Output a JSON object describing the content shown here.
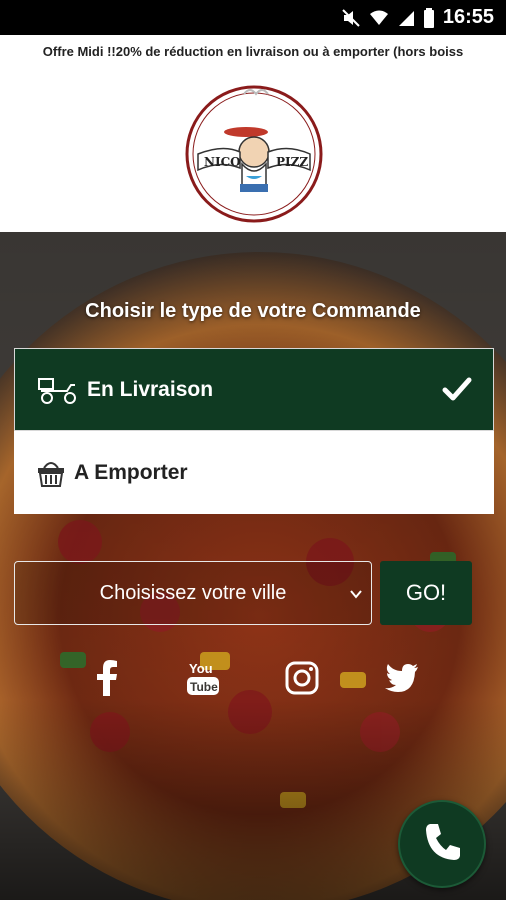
{
  "status_bar": {
    "time": "16:55"
  },
  "marquee": {
    "text": "Offre Midi !!20% de réduction en livraison ou à emporter (hors boiss"
  },
  "logo": {
    "alt": "NICO PIZZ'"
  },
  "order": {
    "heading": "Choisir le type de votre Commande",
    "delivery_label": "En Livraison",
    "takeaway_label": "A Emporter",
    "selected": "delivery"
  },
  "city": {
    "placeholder": "Choisissez votre ville"
  },
  "go_label": "GO!",
  "social": {
    "youtube_text": "You Tube"
  },
  "colors": {
    "accent": "#0f3a22",
    "white": "#ffffff"
  }
}
